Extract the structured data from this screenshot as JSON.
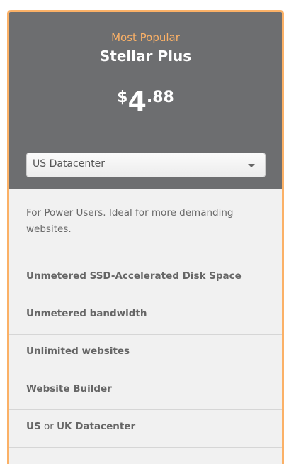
{
  "plan": {
    "badge": "Most Popular",
    "name": "Stellar Plus",
    "price": {
      "currency": "$",
      "integer": "4",
      "decimal": ".88"
    }
  },
  "datacenter_select": {
    "selected": "US Datacenter"
  },
  "description": "For Power Users. Ideal for more demanding websites.",
  "features": [
    "Unmetered SSD-Accelerated Disk Space",
    "Unmetered bandwidth",
    "Unlimited websites",
    "Website Builder"
  ],
  "last_feature": {
    "part1": "US",
    "part2": " or ",
    "part3": "UK Datacenter"
  },
  "colors": {
    "accent": "#fbb167",
    "header_bg": "#6d6e70",
    "body_bg": "#f1f1f1"
  }
}
